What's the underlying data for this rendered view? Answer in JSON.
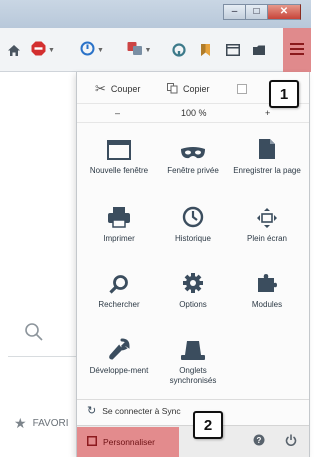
{
  "window": {
    "minimize_glyph": "–",
    "maximize_glyph": "□",
    "close_glyph": "✕"
  },
  "toolbar": {
    "icons": [
      "home-icon",
      "adblock-icon",
      "reload-icon",
      "translate-icon",
      "pocket-icon",
      "bookmark-icon",
      "sidebar-icon",
      "downloads-icon"
    ],
    "menu_button": "hamburger-menu-icon"
  },
  "page": {
    "favorites_label": "FAVORI"
  },
  "menu": {
    "edit": {
      "cut": "Couper",
      "copy": "Copier"
    },
    "zoom": {
      "minus": "–",
      "level": "100 %",
      "plus": "+"
    },
    "items": [
      {
        "label": "Nouvelle fenêtre",
        "icon": "new-window-icon"
      },
      {
        "label": "Fenêtre privée",
        "icon": "private-mask-icon"
      },
      {
        "label": "Enregistrer la page",
        "icon": "save-page-icon"
      },
      {
        "label": "Imprimer",
        "icon": "print-icon"
      },
      {
        "label": "Historique",
        "icon": "history-clock-icon"
      },
      {
        "label": "Plein écran",
        "icon": "fullscreen-icon"
      },
      {
        "label": "Rechercher",
        "icon": "search-icon"
      },
      {
        "label": "Options",
        "icon": "options-gear-icon"
      },
      {
        "label": "Modules",
        "icon": "addons-puzzle-icon"
      },
      {
        "label": "Développe-ment",
        "icon": "developer-wrench-icon"
      },
      {
        "label": "Onglets synchronisés",
        "icon": "synced-tabs-icon"
      }
    ],
    "sync_label": "Se connecter à Sync",
    "customize_label": "Personnaliser",
    "help_icon": "help-icon",
    "quit_icon": "power-icon"
  },
  "callouts": {
    "first": "1",
    "second": "2"
  },
  "colors": {
    "highlight": "#e38b8d",
    "accent": "#3b4d5e"
  }
}
